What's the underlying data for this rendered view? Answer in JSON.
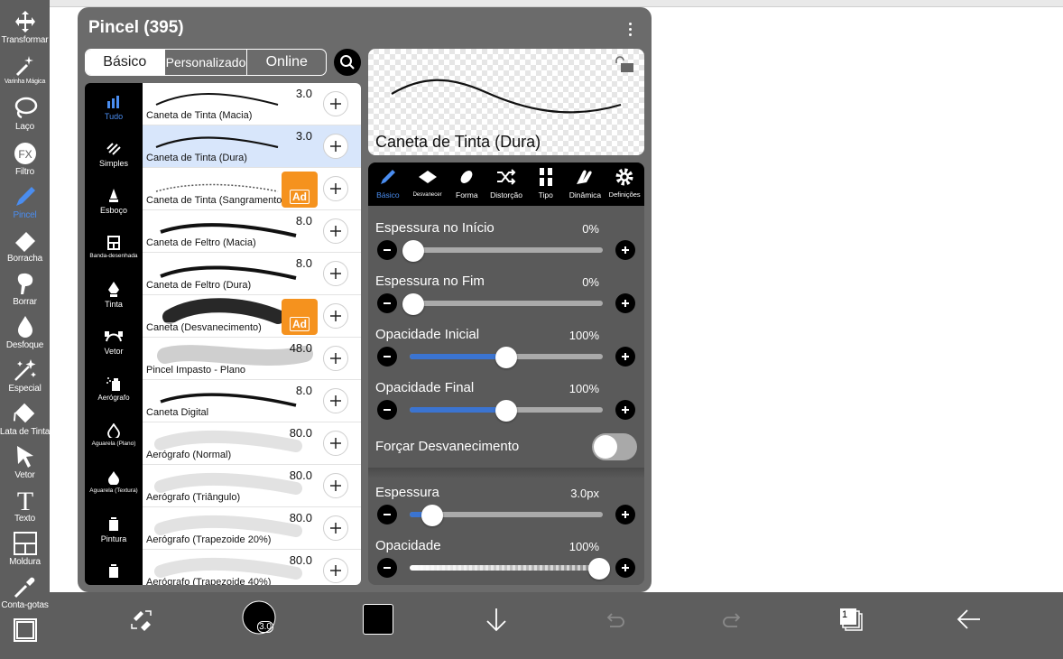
{
  "toolbar": {
    "tools": [
      {
        "label": "Transformar",
        "icon": "move-arrows-icon"
      },
      {
        "label": "Varinha Mágica",
        "icon": "magic-wand-icon"
      },
      {
        "label": "Laço",
        "icon": "lasso-icon"
      },
      {
        "label": "Filtro",
        "icon": "fx-filter-icon"
      },
      {
        "label": "Pincel",
        "icon": "brush-icon",
        "active": true
      },
      {
        "label": "Borracha",
        "icon": "eraser-icon"
      },
      {
        "label": "Borrar",
        "icon": "smudge-icon"
      },
      {
        "label": "Desfoque",
        "icon": "blur-drop-icon"
      },
      {
        "label": "Especial",
        "icon": "special-sparkle-icon"
      },
      {
        "label": "Lata de Tinta",
        "icon": "paint-bucket-icon"
      },
      {
        "label": "Vetor",
        "icon": "vector-arrow-icon"
      },
      {
        "label": "Texto",
        "icon": "text-t-icon"
      },
      {
        "label": "Moldura",
        "icon": "frame-icon"
      },
      {
        "label": "Conta-gotas",
        "icon": "eyedropper-icon"
      }
    ]
  },
  "panel": {
    "title": "Pincel (395)",
    "tabs": [
      "Básico",
      "Personalizado",
      "Online"
    ],
    "active_tab": "Básico",
    "categories": [
      {
        "label": "Tudo",
        "active": true
      },
      {
        "label": "Simples"
      },
      {
        "label": "Esboço"
      },
      {
        "label": "Banda-desenhada"
      },
      {
        "label": "Tinta"
      },
      {
        "label": "Vetor"
      },
      {
        "label": "Aerógrafo"
      },
      {
        "label": "Aguarela (Plano)"
      },
      {
        "label": "Aguarela (Textura)"
      },
      {
        "label": "Pintura"
      },
      {
        "label": ""
      }
    ],
    "brushes": [
      {
        "name": "Caneta de Tinta (Macia)",
        "size": "3.0"
      },
      {
        "name": "Caneta de Tinta (Dura)",
        "size": "3.0",
        "selected": true
      },
      {
        "name": "Caneta de Tinta (Sangramento)",
        "size": "",
        "ad": "Ad"
      },
      {
        "name": "Caneta de Feltro (Macia)",
        "size": "8.0"
      },
      {
        "name": "Caneta de Feltro (Dura)",
        "size": "8.0"
      },
      {
        "name": "Caneta (Desvanecimento)",
        "size": "",
        "ad": "Ad"
      },
      {
        "name": "Pincel Impasto - Plano",
        "size": "48.0"
      },
      {
        "name": "Caneta Digital",
        "size": "8.0"
      },
      {
        "name": "Aerógrafo (Normal)",
        "size": "80.0"
      },
      {
        "name": "Aerógrafo (Triângulo)",
        "size": "80.0"
      },
      {
        "name": "Aerógrafo (Trapezoide 20%)",
        "size": "80.0"
      },
      {
        "name": "Aerógrafo (Trapezoide 40%)",
        "size": "80.0"
      }
    ],
    "preview_name": "Caneta de Tinta (Dura)",
    "settings_tabs": [
      {
        "label": "Básico",
        "active": true
      },
      {
        "label": "Desvanecer"
      },
      {
        "label": "Forma"
      },
      {
        "label": "Distorção"
      },
      {
        "label": "Tipo"
      },
      {
        "label": "Dinâmica"
      },
      {
        "label": "Definições"
      }
    ],
    "params": [
      {
        "label": "Espessura no Início",
        "value": "0%",
        "level": 0.0,
        "blue": false
      },
      {
        "label": "Espessura no Fim",
        "value": "0%",
        "level": 0.0,
        "blue": false
      },
      {
        "label": "Opacidade Inicial",
        "value": "100%",
        "level": 0.5,
        "blue": true
      },
      {
        "label": "Opacidade Final",
        "value": "100%",
        "level": 0.5,
        "blue": true
      }
    ],
    "fade_toggle": {
      "label": "Forçar Desvanecimento",
      "on": false
    },
    "params2": [
      {
        "label": "Espessura",
        "value": "3.0px",
        "level": 0.1,
        "blue": true
      },
      {
        "label": "Opacidade",
        "value": "100%",
        "level": 1.0,
        "checker": true
      }
    ]
  },
  "bottombar": {
    "brush_size": "3.0",
    "color": "#000000",
    "layer_count": "1",
    "icons": [
      "swap-brush-eraser-icon",
      "brush-size-icon",
      "color-swatch-icon",
      "download-arrow-icon",
      "undo-icon",
      "redo-icon",
      "layers-icon",
      "back-arrow-icon"
    ]
  }
}
